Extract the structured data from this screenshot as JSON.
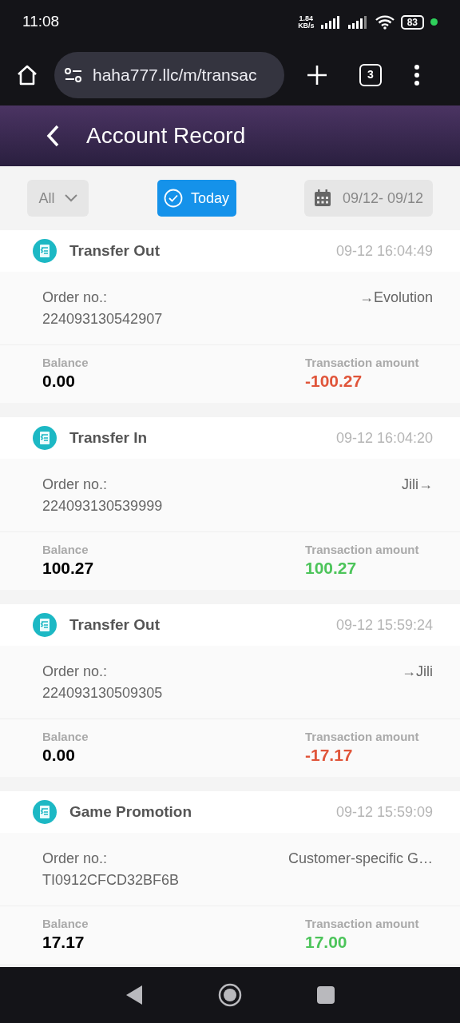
{
  "status_bar": {
    "time": "11:08",
    "speed": "1.84",
    "speed_unit": "KB/s",
    "battery": "83"
  },
  "browser": {
    "url": "haha777.llc/m/transac",
    "tab_count": "3"
  },
  "header": {
    "title": "Account Record"
  },
  "filters": {
    "type": "All",
    "today": {
      "label": "Today",
      "selected": true
    },
    "date_range": "09/12- 09/12"
  },
  "records": [
    {
      "title": "Transfer Out",
      "time": "09-12 16:04:49",
      "order_label": "Order no.:",
      "order_no": "224093130542907",
      "counterparty": "→Evolution",
      "balance_label": "Balance",
      "balance": "0.00",
      "amount_label": "Transaction amount",
      "amount": "-100.27",
      "kind": "debit"
    },
    {
      "title": "Transfer In",
      "time": "09-12 16:04:20",
      "order_label": "Order no.:",
      "order_no": "224093130539999",
      "counterparty": "Jili→",
      "balance_label": "Balance",
      "balance": "100.27",
      "amount_label": "Transaction amount",
      "amount": "100.27",
      "kind": "credit"
    },
    {
      "title": "Transfer Out",
      "time": "09-12 15:59:24",
      "order_label": "Order no.:",
      "order_no": "224093130509305",
      "counterparty": "→Jili",
      "balance_label": "Balance",
      "balance": "0.00",
      "amount_label": "Transaction amount",
      "amount": "-17.17",
      "kind": "debit"
    },
    {
      "title": "Game Promotion",
      "time": "09-12 15:59:09",
      "order_label": "Order no.:",
      "order_no": "TI0912CFCD32BF6B",
      "counterparty": "Customer-specific G…",
      "balance_label": "Balance",
      "balance": "17.17",
      "amount_label": "Transaction amount",
      "amount": "17.00",
      "kind": "credit"
    }
  ]
}
